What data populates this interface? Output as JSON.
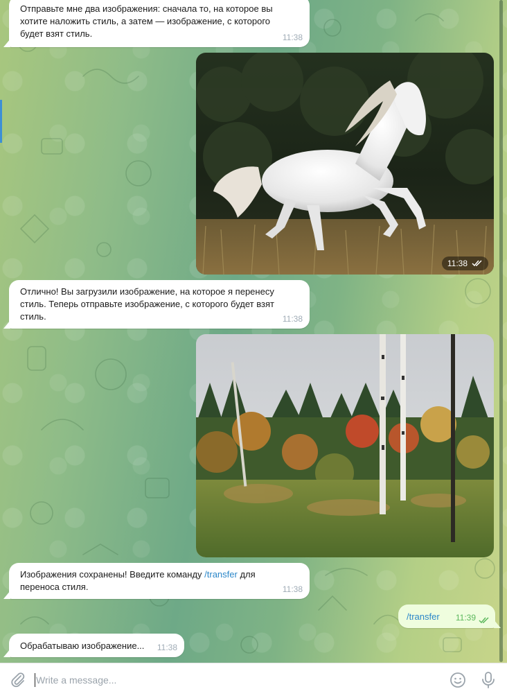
{
  "messages": [
    {
      "direction": "incoming",
      "type": "text",
      "text": "Отправьте мне два изображения: сначала то, на которое вы хотите наложить стиль, а затем — изображение, с которого будет взят стиль.",
      "lines": [
        "Отправьте мне два изображения: сначала то, на которое вы",
        "хотите наложить стиль, а затем — изображение, с которого",
        "будет взят стиль."
      ],
      "time": "11:38"
    },
    {
      "direction": "outgoing",
      "type": "photo",
      "subject": "white horse galloping in a field",
      "time": "11:38",
      "status": "read"
    },
    {
      "direction": "incoming",
      "type": "text",
      "lines": [
        "Отлично! Вы загрузили изображение, на которое я перенесу",
        "стиль. Теперь отправьте изображение, с которого будет взят",
        "стиль."
      ],
      "time": "11:38"
    },
    {
      "direction": "outgoing",
      "type": "photo",
      "subject": "autumn forest with birch trees",
      "time": "",
      "status": ""
    },
    {
      "direction": "incoming",
      "type": "text",
      "line1_before": "Изображения сохранены! Введите команду ",
      "line1_command": "/transfer",
      "line1_after": " для",
      "line2": "переноса стиля.",
      "time": "11:38"
    },
    {
      "direction": "outgoing",
      "type": "text",
      "text": "/transfer",
      "time": "11:39",
      "status": "read"
    },
    {
      "direction": "incoming",
      "type": "text",
      "text": "Обрабатываю изображение...",
      "time": "11:38"
    }
  ],
  "composer": {
    "placeholder": "Write a message...",
    "attach_icon": "paperclip-icon",
    "emoji_icon": "smiley-icon",
    "voice_icon": "microphone-icon"
  },
  "colors": {
    "incoming_bubble": "#ffffff",
    "outgoing_bubble": "#effdde",
    "link": "#2a86c8",
    "timestamp_incoming": "#a0acb6",
    "timestamp_outgoing": "#5cb85c"
  }
}
